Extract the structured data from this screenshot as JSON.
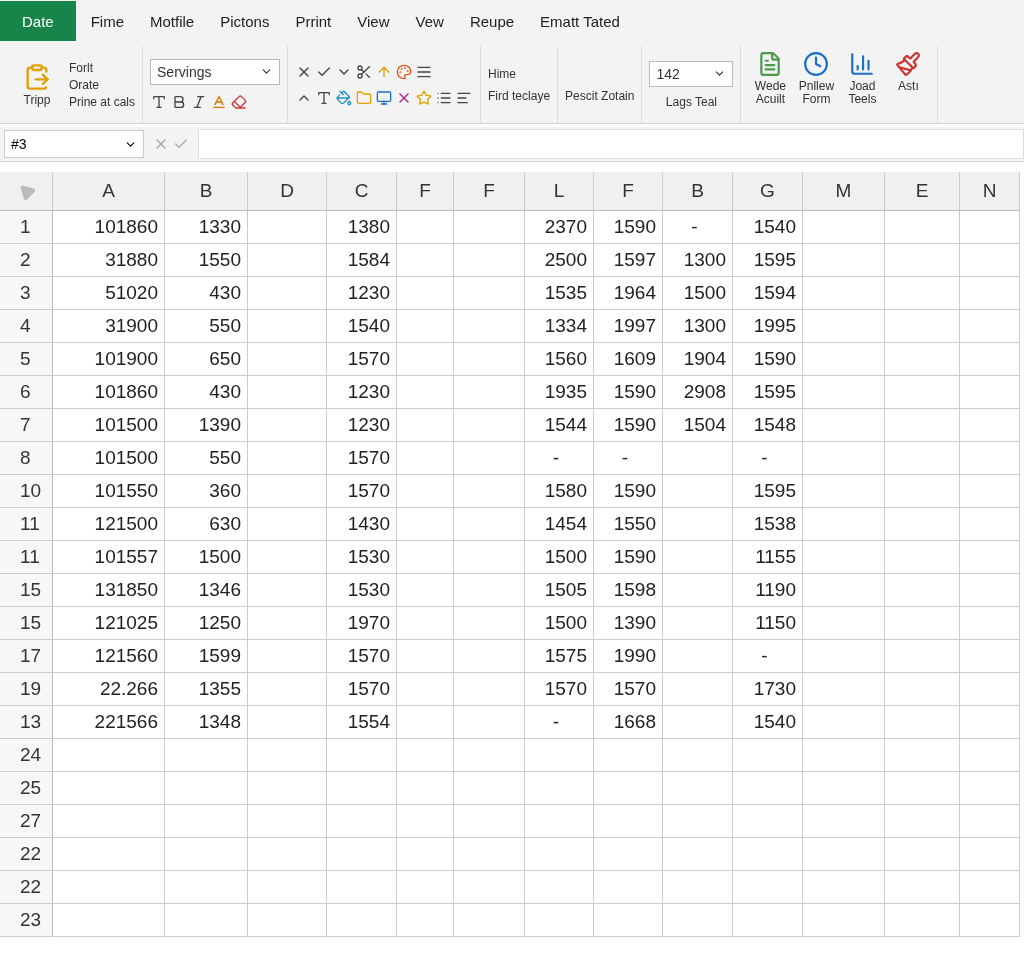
{
  "tabs": [
    {
      "label": "Date",
      "selected": true
    },
    {
      "label": "Fime",
      "selected": false
    },
    {
      "label": "Motfile",
      "selected": false
    },
    {
      "label": "Pictons",
      "selected": false
    },
    {
      "label": "Prrint",
      "selected": false
    },
    {
      "label": "View",
      "selected": false
    },
    {
      "label": "Vew",
      "selected": false
    },
    {
      "label": "Reupe",
      "selected": false
    },
    {
      "label": "Ematt Tated",
      "selected": false
    }
  ],
  "ribbon": {
    "clipboard": {
      "label": "Tripp",
      "items": [
        "Forlt",
        "Orate",
        "Prine at cals"
      ]
    },
    "font_dropdown": "Servings",
    "style_dropdown": "Hime",
    "find_label": "Fird teclaye",
    "zoom_label": "Pescit Zotain",
    "size_dropdown": "142",
    "size_label": "Lags Teal",
    "large_buttons": [
      {
        "label": "Wede Acuilt"
      },
      {
        "label": "Pnllew Form"
      },
      {
        "label": "Joad Teels"
      },
      {
        "label": "Astı"
      }
    ]
  },
  "formula_bar": {
    "name_box": "#3"
  },
  "sheet": {
    "columns": [
      "A",
      "B",
      "D",
      "C",
      "F",
      "F",
      "L",
      "F",
      "B",
      "G",
      "M",
      "E",
      "N"
    ],
    "rows": [
      {
        "header": "1",
        "cells": [
          "101860",
          "1330",
          null,
          "1380",
          null,
          null,
          "2370",
          "1590",
          "-",
          "1540",
          null,
          null,
          null
        ]
      },
      {
        "header": "2",
        "cells": [
          "31880",
          "1550",
          null,
          "1584",
          null,
          null,
          "2500",
          "1597",
          "1300",
          "1595",
          null,
          null,
          null
        ]
      },
      {
        "header": "3",
        "cells": [
          "51020",
          "430",
          null,
          "1230",
          null,
          null,
          "1535",
          "1964",
          "1500",
          "1594",
          null,
          null,
          null
        ]
      },
      {
        "header": "4",
        "cells": [
          "31900",
          "550",
          null,
          "1540",
          null,
          null,
          "1334",
          "1997",
          "1300",
          "1995",
          null,
          null,
          null
        ]
      },
      {
        "header": "5",
        "cells": [
          "101900",
          "650",
          null,
          "1570",
          null,
          null,
          "1560",
          "1609",
          "1904",
          "1590",
          null,
          null,
          null
        ]
      },
      {
        "header": "6",
        "cells": [
          "101860",
          "430",
          null,
          "1230",
          null,
          null,
          "1935",
          "1590",
          "2908",
          "1595",
          null,
          null,
          null
        ]
      },
      {
        "header": "7",
        "cells": [
          "101500",
          "1390",
          null,
          "1230",
          null,
          null,
          "1544",
          "1590",
          "1504",
          "1548",
          null,
          null,
          null
        ]
      },
      {
        "header": "8",
        "cells": [
          "101500",
          "550",
          null,
          "1570",
          null,
          null,
          "-",
          "-",
          null,
          "-",
          null,
          null,
          null
        ]
      },
      {
        "header": "10",
        "cells": [
          "101550",
          "360",
          null,
          "1570",
          null,
          null,
          "1580",
          "1590",
          null,
          "1595",
          null,
          null,
          null
        ]
      },
      {
        "header": "11",
        "cells": [
          "121500",
          "630",
          null,
          "1430",
          null,
          null,
          "1454",
          "1550",
          null,
          "1538",
          null,
          null,
          null
        ]
      },
      {
        "header": "11",
        "cells": [
          "101557",
          "1500",
          null,
          "1530",
          null,
          null,
          "1500",
          "1590",
          null,
          "1155",
          null,
          null,
          null
        ]
      },
      {
        "header": "15",
        "cells": [
          "131850",
          "1346",
          null,
          "1530",
          null,
          null,
          "1505",
          "1598",
          null,
          "1190",
          null,
          null,
          null
        ]
      },
      {
        "header": "15",
        "cells": [
          "121025",
          "1250",
          null,
          "1970",
          null,
          null,
          "1500",
          "1390",
          null,
          "1150",
          null,
          null,
          null
        ]
      },
      {
        "header": "17",
        "cells": [
          "121560",
          "1599",
          null,
          "1570",
          null,
          null,
          "1575",
          "1990",
          null,
          "-",
          null,
          null,
          null
        ]
      },
      {
        "header": "19",
        "cells": [
          "22.266",
          "1355",
          null,
          "1570",
          null,
          null,
          "1570",
          "1570",
          null,
          "1730",
          null,
          null,
          null
        ]
      },
      {
        "header": "13",
        "cells": [
          "221566",
          "1348",
          null,
          "1554",
          null,
          null,
          "-",
          "1668",
          null,
          "1540",
          null,
          null,
          null
        ]
      },
      {
        "header": "24",
        "cells": []
      },
      {
        "header": "25",
        "cells": []
      },
      {
        "header": "27",
        "cells": []
      },
      {
        "header": "22",
        "cells": []
      },
      {
        "header": "22",
        "cells": []
      },
      {
        "header": "23",
        "cells": []
      }
    ]
  }
}
